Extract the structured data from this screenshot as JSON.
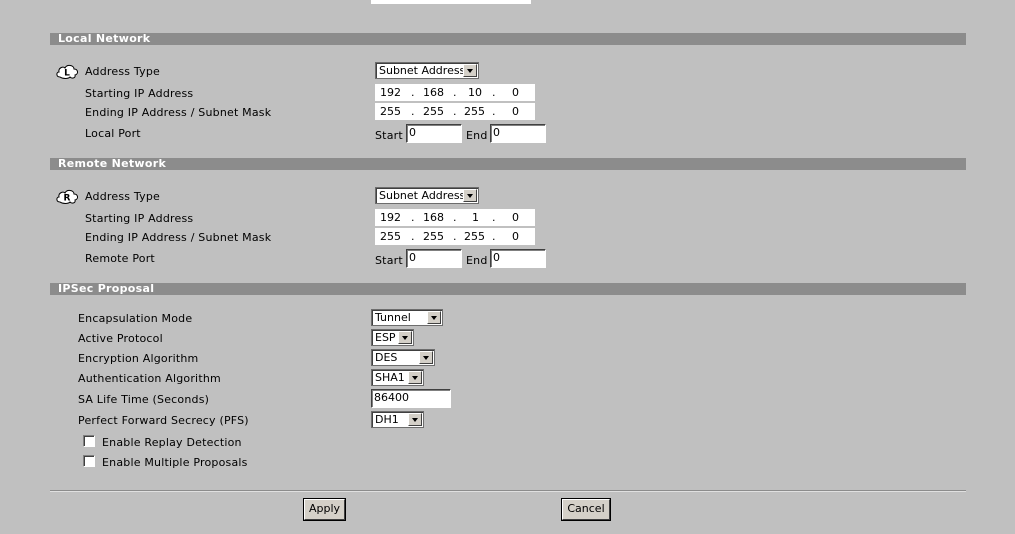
{
  "local": {
    "title": "Local Network",
    "address_type_label": "Address Type",
    "address_type_value": "Subnet Address",
    "starting_ip_label": "Starting IP Address",
    "starting_ip": [
      "192",
      "168",
      "10",
      "0"
    ],
    "ending_ip_label": "Ending IP Address / Subnet Mask",
    "ending_ip": [
      "255",
      "255",
      "255",
      "0"
    ],
    "port_label": "Local Port",
    "start_label": "Start",
    "start_value": "0",
    "end_label": "End",
    "end_value": "0",
    "icon_letter": "L"
  },
  "remote": {
    "title": "Remote Network",
    "address_type_label": "Address Type",
    "address_type_value": "Subnet Address",
    "starting_ip_label": "Starting IP Address",
    "starting_ip": [
      "192",
      "168",
      "1",
      "0"
    ],
    "ending_ip_label": "Ending IP Address / Subnet Mask",
    "ending_ip": [
      "255",
      "255",
      "255",
      "0"
    ],
    "port_label": "Remote Port",
    "start_label": "Start",
    "start_value": "0",
    "end_label": "End",
    "end_value": "0",
    "icon_letter": "R"
  },
  "ipsec": {
    "title": "IPSec Proposal",
    "encapsulation_label": "Encapsulation Mode",
    "encapsulation_value": "Tunnel",
    "protocol_label": "Active Protocol",
    "protocol_value": "ESP",
    "encryption_label": "Encryption Algorithm",
    "encryption_value": "DES",
    "authentication_label": "Authentication Algorithm",
    "authentication_value": "SHA1",
    "sa_lifetime_label": "SA Life Time (Seconds)",
    "sa_lifetime_value": "86400",
    "pfs_label": "Perfect Forward Secrecy (PFS)",
    "pfs_value": "DH1",
    "replay_label": "Enable Replay Detection",
    "replay_checked": false,
    "multiple_label": "Enable Multiple Proposals",
    "multiple_checked": false
  },
  "buttons": {
    "apply": "Apply",
    "cancel": "Cancel"
  }
}
